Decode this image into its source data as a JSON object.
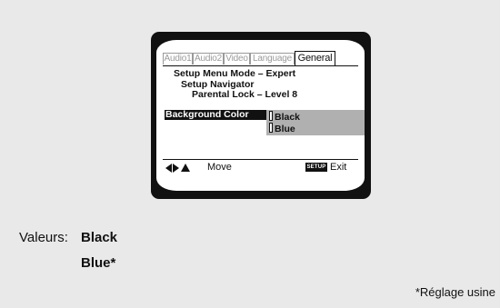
{
  "tabs": [
    {
      "label": "Audio1",
      "active": false
    },
    {
      "label": "Audio2",
      "active": false
    },
    {
      "label": "Video",
      "active": false
    },
    {
      "label": "Language",
      "active": false
    },
    {
      "label": "General",
      "active": true
    }
  ],
  "menu": {
    "setup_menu_mode": "Setup Menu Mode – Expert",
    "setup_navigator": "Setup Navigator",
    "parental_lock": "Parental Lock – Level 8",
    "background_color_label": "Background Color",
    "options": [
      "Black",
      "Blue"
    ]
  },
  "footer": {
    "move_label": "Move",
    "setup_key": "SETUP",
    "exit_label": "Exit"
  },
  "caption": {
    "valeurs_label": "Valeurs:",
    "values": [
      "Black",
      "Blue*"
    ],
    "footnote": "*Réglage usine"
  }
}
